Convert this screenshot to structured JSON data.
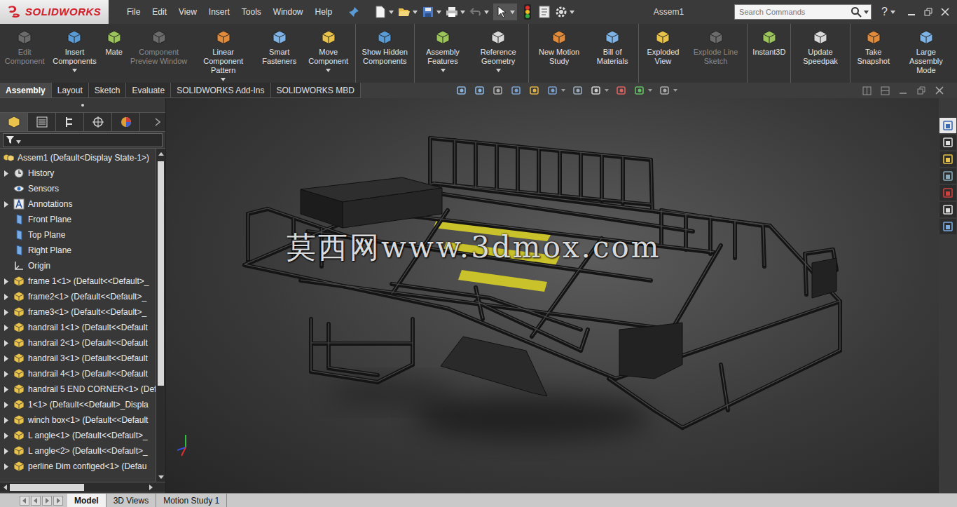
{
  "app": {
    "logo": "SOLIDWORKS",
    "document_title": "Assem1",
    "help_glyph": "?"
  },
  "menu": [
    "File",
    "Edit",
    "View",
    "Insert",
    "Tools",
    "Window",
    "Help"
  ],
  "search": {
    "placeholder": "Search Commands"
  },
  "ribbon": [
    [
      {
        "label": "Edit Component",
        "disabled": true,
        "dropdown": false
      },
      {
        "label": "Insert Components",
        "disabled": false,
        "dropdown": true
      },
      {
        "label": "Mate",
        "disabled": false,
        "dropdown": false
      },
      {
        "label": "Component Preview Window",
        "disabled": true,
        "dropdown": false
      },
      {
        "label": "Linear Component Pattern",
        "disabled": false,
        "dropdown": true
      },
      {
        "label": "Smart Fasteners",
        "disabled": false,
        "dropdown": false
      },
      {
        "label": "Move Component",
        "disabled": false,
        "dropdown": true
      }
    ],
    [
      {
        "label": "Show Hidden Components",
        "disabled": false,
        "dropdown": false
      }
    ],
    [
      {
        "label": "Assembly Features",
        "disabled": false,
        "dropdown": true
      },
      {
        "label": "Reference Geometry",
        "disabled": false,
        "dropdown": true
      }
    ],
    [
      {
        "label": "New Motion Study",
        "disabled": false,
        "dropdown": false
      },
      {
        "label": "Bill of Materials",
        "disabled": false,
        "dropdown": false
      }
    ],
    [
      {
        "label": "Exploded View",
        "disabled": false,
        "dropdown": false
      },
      {
        "label": "Explode Line Sketch",
        "disabled": true,
        "dropdown": false
      }
    ],
    [
      {
        "label": "Instant3D",
        "disabled": false,
        "dropdown": false
      }
    ],
    [
      {
        "label": "Update Speedpak",
        "disabled": false,
        "dropdown": false
      }
    ],
    [
      {
        "label": "Take Snapshot",
        "disabled": false,
        "dropdown": false
      },
      {
        "label": "Large Assembly Mode",
        "disabled": false,
        "dropdown": false
      }
    ]
  ],
  "tabs": [
    {
      "label": "Assembly",
      "selected": true
    },
    {
      "label": "Layout",
      "selected": false
    },
    {
      "label": "Sketch",
      "selected": false
    },
    {
      "label": "Evaluate",
      "selected": false
    },
    {
      "label": "SOLIDWORKS Add-Ins",
      "selected": false
    },
    {
      "label": "SOLIDWORKS MBD",
      "selected": false
    }
  ],
  "tree": {
    "root": {
      "label": "Assem1  (Default<Display State-1>)",
      "kind": "assembly"
    },
    "items": [
      {
        "label": "History",
        "kind": "history",
        "expandable": true
      },
      {
        "label": "Sensors",
        "kind": "sensors",
        "expandable": false
      },
      {
        "label": "Annotations",
        "kind": "annotations",
        "expandable": true
      },
      {
        "label": "Front Plane",
        "kind": "plane",
        "expandable": false
      },
      {
        "label": "Top Plane",
        "kind": "plane",
        "expandable": false
      },
      {
        "label": "Right Plane",
        "kind": "plane",
        "expandable": false
      },
      {
        "label": "Origin",
        "kind": "origin",
        "expandable": false
      },
      {
        "label": "frame 1<1> (Default<<Default>_",
        "kind": "part",
        "expandable": true
      },
      {
        "label": "frame2<1> (Default<<Default>_",
        "kind": "part",
        "expandable": true
      },
      {
        "label": "frame3<1> (Default<<Default>_",
        "kind": "part",
        "expandable": true
      },
      {
        "label": "handrail 1<1> (Default<<Default",
        "kind": "part",
        "expandable": true
      },
      {
        "label": "handrail 2<1> (Default<<Default",
        "kind": "part",
        "expandable": true
      },
      {
        "label": "handrail 3<1> (Default<<Default",
        "kind": "part",
        "expandable": true
      },
      {
        "label": "handrail 4<1> (Default<<Default",
        "kind": "part",
        "expandable": true
      },
      {
        "label": "handrail 5 END CORNER<1> (Def",
        "kind": "part",
        "expandable": true
      },
      {
        "label": "1<1> (Default<<Default>_Displa",
        "kind": "part",
        "expandable": true
      },
      {
        "label": "winch box<1> (Default<<Default",
        "kind": "part",
        "expandable": true
      },
      {
        "label": "L angle<1> (Default<<Default>_",
        "kind": "part",
        "expandable": true
      },
      {
        "label": "L angle<2> (Default<<Default>_",
        "kind": "part",
        "expandable": true
      },
      {
        "label": "perline Dim configed<1> (Defau",
        "kind": "part",
        "expandable": true
      }
    ]
  },
  "watermark": "莫西网www.3dmox.com",
  "bottom_tabs": [
    {
      "label": "Model",
      "selected": true
    },
    {
      "label": "3D Views",
      "selected": false
    },
    {
      "label": "Motion Study 1",
      "selected": false
    }
  ]
}
